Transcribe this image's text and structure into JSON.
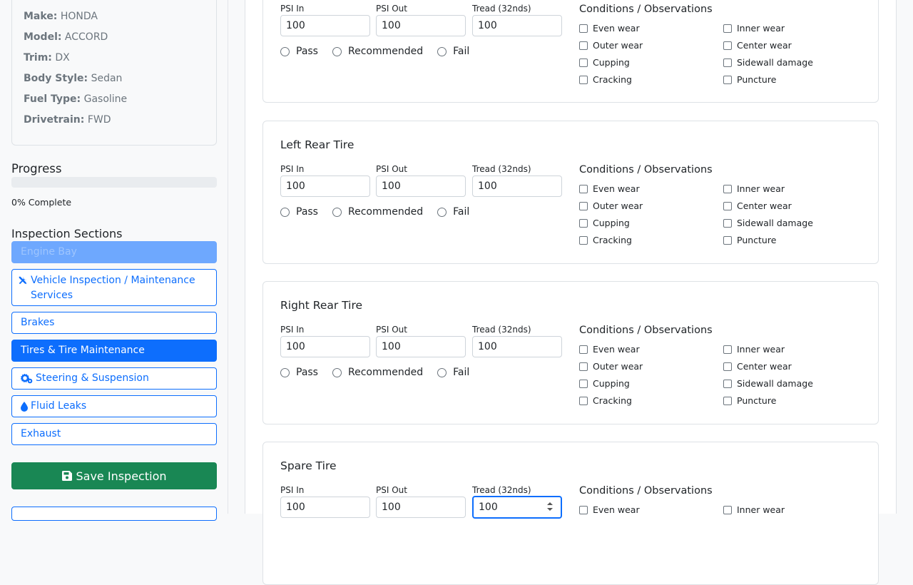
{
  "vehicle": {
    "make_label": "Make:",
    "make": "HONDA",
    "model_label": "Model:",
    "model": "ACCORD",
    "trim_label": "Trim:",
    "trim": "DX",
    "body_label": "Body Style:",
    "body": "Sedan",
    "fuel_label": "Fuel Type:",
    "fuel": "Gasoline",
    "drive_label": "Drivetrain:",
    "drive": "FWD"
  },
  "progress": {
    "title": "Progress",
    "text": "0% Complete",
    "percent": 0
  },
  "sections": {
    "title": "Inspection Sections",
    "items": [
      {
        "label": "Engine Bay",
        "icon": "none",
        "state": "disabled"
      },
      {
        "label": "Vehicle Inspection / Maintenance Services",
        "icon": "tools-icon",
        "state": "normal"
      },
      {
        "label": "Brakes",
        "icon": "none",
        "state": "normal"
      },
      {
        "label": "Tires & Tire Maintenance",
        "icon": "none",
        "state": "active"
      },
      {
        "label": "Steering & Suspension",
        "icon": "gears-icon",
        "state": "normal"
      },
      {
        "label": "Fluid Leaks",
        "icon": "droplet-icon",
        "state": "normal"
      },
      {
        "label": "Exhaust",
        "icon": "none",
        "state": "normal"
      }
    ]
  },
  "save_label": "Save Inspection",
  "labels": {
    "psi_in": "PSI In",
    "psi_out": "PSI Out",
    "tread": "Tread (32nds)",
    "pass": "Pass",
    "recommended": "Recommended",
    "fail": "Fail",
    "conditions": "Conditions / Observations",
    "even": "Even wear",
    "outer": "Outer wear",
    "cupping": "Cupping",
    "cracking": "Cracking",
    "inner": "Inner wear",
    "center": "Center wear",
    "sidewall": "Sidewall damage",
    "puncture": "Puncture"
  },
  "tires": [
    {
      "title": "",
      "psi_in": "100",
      "psi_out": "100",
      "tread": "100"
    },
    {
      "title": "Left Rear Tire",
      "psi_in": "100",
      "psi_out": "100",
      "tread": "100"
    },
    {
      "title": "Right Rear Tire",
      "psi_in": "100",
      "psi_out": "100",
      "tread": "100"
    },
    {
      "title": "Spare Tire",
      "psi_in": "100",
      "psi_out": "100",
      "tread": "100"
    }
  ],
  "colors": {
    "primary": "#0d6efd",
    "success": "#198754",
    "border": "#dee2e6"
  }
}
